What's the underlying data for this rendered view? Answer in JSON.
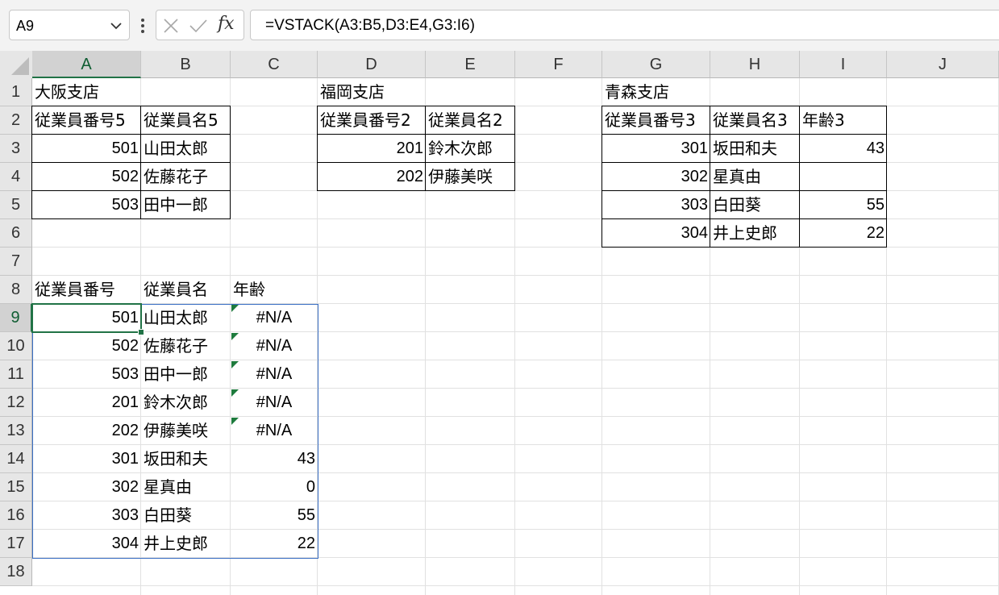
{
  "name_box": {
    "value": "A9"
  },
  "formula": {
    "fx_label": "fx",
    "text": "=VSTACK(A3:B5,D3:E4,G3:I6)"
  },
  "active_cell": "A9",
  "columns": [
    "A",
    "B",
    "C",
    "D",
    "E",
    "F",
    "G",
    "H",
    "I",
    "J"
  ],
  "rows": [
    "1",
    "2",
    "3",
    "4",
    "5",
    "6",
    "7",
    "8",
    "9",
    "10",
    "11",
    "12",
    "13",
    "14",
    "15",
    "16",
    "17",
    "18"
  ],
  "cells": {
    "A1": "大阪支店",
    "D1": "福岡支店",
    "G1": "青森支店",
    "A2": "従業員番号5",
    "B2": "従業員名5",
    "D2": "従業員番号2",
    "E2": "従業員名2",
    "G2": "従業員番号3",
    "H2": "従業員名3",
    "I2": "年齢3",
    "A3": "501",
    "B3": "山田太郎",
    "D3": "201",
    "E3": "鈴木次郎",
    "G3": "301",
    "H3": "坂田和夫",
    "I3": "43",
    "A4": "502",
    "B4": "佐藤花子",
    "D4": "202",
    "E4": "伊藤美咲",
    "G4": "302",
    "H4": "星真由",
    "A5": "503",
    "B5": "田中一郎",
    "G5": "303",
    "H5": "白田葵",
    "I5": "55",
    "G6": "304",
    "H6": "井上史郎",
    "I6": "22",
    "A8": "従業員番号",
    "B8": "従業員名",
    "C8": "年齢",
    "A9": "501",
    "B9": "山田太郎",
    "C9": "#N/A",
    "A10": "502",
    "B10": "佐藤花子",
    "C10": "#N/A",
    "A11": "503",
    "B11": "田中一郎",
    "C11": "#N/A",
    "A12": "201",
    "B12": "鈴木次郎",
    "C12": "#N/A",
    "A13": "202",
    "B13": "伊藤美咲",
    "C13": "#N/A",
    "A14": "301",
    "B14": "坂田和夫",
    "C14": "43",
    "A15": "302",
    "B15": "星真由",
    "C15": "0",
    "A16": "303",
    "B16": "白田葵",
    "C16": "55",
    "A17": "304",
    "B17": "井上史郎",
    "C17": "22"
  },
  "colors": {
    "accent": "#217346",
    "selection": "#3a6fc4",
    "error_triangle": "#1e7b3d"
  }
}
